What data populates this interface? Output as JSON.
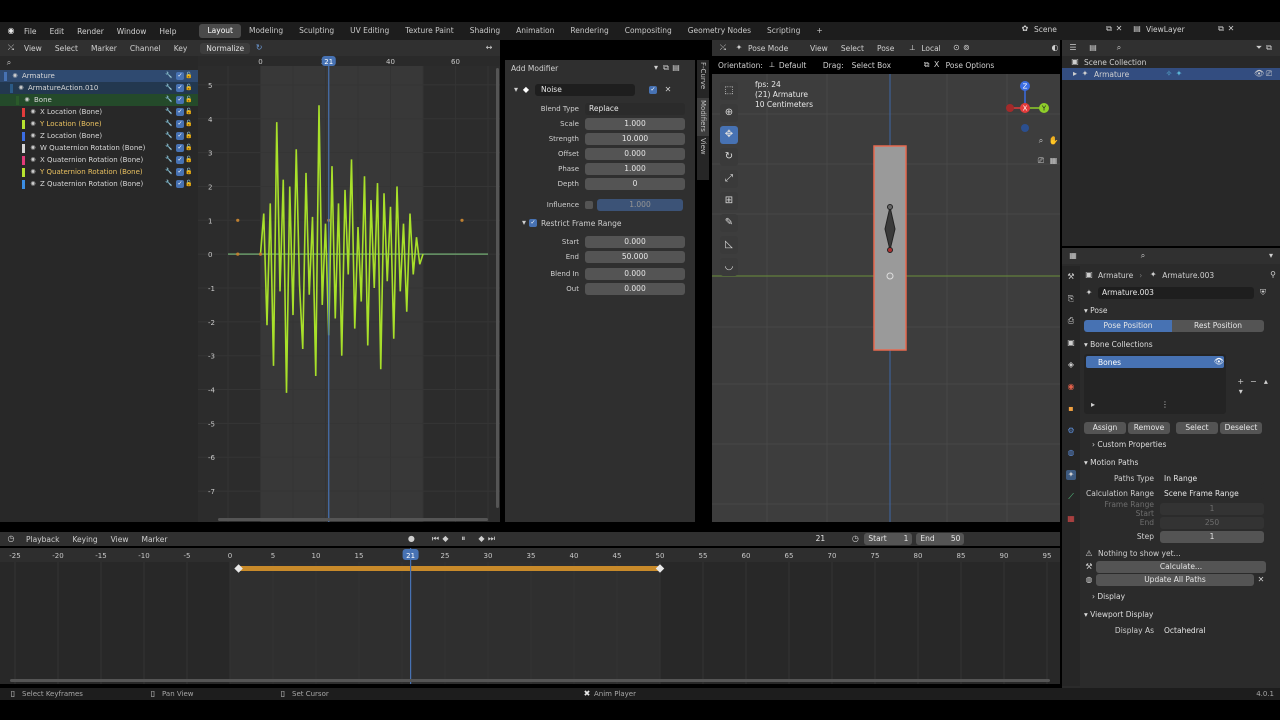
{
  "topbar": {
    "menus": [
      "File",
      "Edit",
      "Render",
      "Window",
      "Help"
    ],
    "workspaces": [
      "Layout",
      "Modeling",
      "Sculpting",
      "UV Editing",
      "Texture Paint",
      "Shading",
      "Animation",
      "Rendering",
      "Compositing",
      "Geometry Nodes",
      "Scripting"
    ],
    "active_workspace": "Layout",
    "add_tab": "+",
    "scene": "Scene",
    "view_layer": "ViewLayer"
  },
  "graph_editor": {
    "menus": [
      "View",
      "Select",
      "Marker",
      "Channel",
      "Key"
    ],
    "normalize": "Normalize",
    "frame_ticks": [
      "0",
      "20",
      "40",
      "60"
    ],
    "current_frame": "21",
    "y_ticks": [
      "5",
      "4",
      "3",
      "2",
      "1",
      "0",
      "-1",
      "-2",
      "-3",
      "-4",
      "-5",
      "-6",
      "-7"
    ],
    "channels": [
      {
        "name": "Armature",
        "color": "#4772b3",
        "level": 0
      },
      {
        "name": "ArmatureAction.010",
        "color": "#2b5a86",
        "level": 1
      },
      {
        "name": "Bone",
        "color": "#2a5a2a",
        "level": 2
      },
      {
        "name": "X Location (Bone)",
        "color": "#e23b3b",
        "level": 3
      },
      {
        "name": "Y Location (Bone)",
        "color": "#b6e32f",
        "level": 3
      },
      {
        "name": "Z Location (Bone)",
        "color": "#3b6de2",
        "level": 3
      },
      {
        "name": "W Quaternion Rotation (Bone)",
        "color": "#d6d6d6",
        "level": 3
      },
      {
        "name": "X Quaternion Rotation (Bone)",
        "color": "#e23b7a",
        "level": 3
      },
      {
        "name": "Y Quaternion Rotation (Bone)",
        "color": "#b6e32f",
        "level": 3
      },
      {
        "name": "Z Quaternion Rotation (Bone)",
        "color": "#3b8de2",
        "level": 3
      }
    ]
  },
  "modifiers": {
    "add_modifier": "Add Modifier",
    "name": "Noise",
    "blend_type_label": "Blend Type",
    "blend_type": "Replace",
    "props": [
      {
        "label": "Scale",
        "value": "1.000"
      },
      {
        "label": "Strength",
        "value": "10.000"
      },
      {
        "label": "Offset",
        "value": "0.000"
      },
      {
        "label": "Phase",
        "value": "1.000"
      },
      {
        "label": "Depth",
        "value": "0"
      }
    ],
    "influence_label": "Influence",
    "influence": "1.000",
    "restrict_label": "Restrict Frame Range",
    "range": [
      {
        "label": "Start",
        "value": "0.000"
      },
      {
        "label": "End",
        "value": "50.000"
      },
      {
        "label": "Blend In",
        "value": "0.000"
      },
      {
        "label": "Out",
        "value": "0.000"
      }
    ],
    "side_tabs": [
      "F-Curve",
      "Modifiers",
      "View"
    ]
  },
  "viewport": {
    "mode": "Pose Mode",
    "menus": [
      "View",
      "Select",
      "Pose"
    ],
    "transform": "Local",
    "orientation_label": "Orientation:",
    "orientation": "Default",
    "drag_label": "Drag:",
    "drag": "Select Box",
    "pose_options": "Pose Options",
    "overlay": [
      "fps: 24",
      "(21) Armature",
      "10 Centimeters"
    ],
    "gizmo_labels": {
      "z": "Z",
      "y": "Y",
      "x": "X"
    }
  },
  "outliner": {
    "title": "Scene Collection",
    "item": "Armature"
  },
  "properties": {
    "breadcrumb_obj": "Armature",
    "breadcrumb_data": "Armature.003",
    "data_name": "Armature.003",
    "pose_section": "Pose",
    "pose_position": "Pose Position",
    "rest_position": "Rest Position",
    "bone_collections": "Bone Collections",
    "bones": "Bones",
    "assign": "Assign",
    "remove": "Remove",
    "select": "Select",
    "deselect": "Deselect",
    "custom_props": "Custom Properties",
    "motion_paths": "Motion Paths",
    "paths_type_label": "Paths Type",
    "paths_type": "In Range",
    "calc_range_label": "Calculation Range",
    "calc_range": "Scene Frame Range",
    "frame_range_start_label": "Frame Range Start",
    "frame_range_start": "1",
    "end_label": "End",
    "end": "250",
    "step_label": "Step",
    "step": "1",
    "nothing": "Nothing to show yet...",
    "calculate": "Calculate...",
    "update_all": "Update All Paths",
    "display": "Display",
    "viewport_display": "Viewport Display",
    "display_as_label": "Display As",
    "display_as": "Octahedral"
  },
  "timeline": {
    "menus": [
      "Playback",
      "Keying",
      "View",
      "Marker"
    ],
    "current_frame": "21",
    "start_label": "Start",
    "start": "1",
    "end_label": "End",
    "end": "50",
    "ticks": [
      "-25",
      "-20",
      "-15",
      "-10",
      "-5",
      "0",
      "5",
      "10",
      "15",
      "21",
      "25",
      "30",
      "35",
      "40",
      "45",
      "50",
      "55",
      "60",
      "65",
      "70",
      "75",
      "80",
      "85",
      "90",
      "95"
    ]
  },
  "statusbar": {
    "select": "Select Keyframes",
    "pan": "Pan View",
    "cursor": "Set Cursor",
    "center": "Anim Player",
    "version": "4.0.1"
  },
  "chart_data": {
    "type": "line",
    "series": [
      {
        "name": "Y Location (Bone)",
        "color": "#a8e02a",
        "x": [
          0,
          1,
          2,
          3,
          4,
          5,
          6,
          7,
          8,
          9,
          10,
          11,
          12,
          13,
          14,
          15,
          16,
          17,
          18,
          19,
          20,
          21,
          22,
          23,
          24,
          25,
          26,
          27,
          28,
          29,
          30,
          31,
          32,
          33,
          34,
          35,
          36,
          37,
          38,
          39,
          40,
          41,
          42,
          43,
          44,
          45,
          46,
          47,
          48,
          49,
          50
        ],
        "values": [
          0,
          1.2,
          -2.1,
          1.5,
          -3.3,
          3.9,
          -1.1,
          2.2,
          -4.1,
          2.0,
          -1.8,
          3.1,
          -0.9,
          -2.8,
          2.4,
          -1.2,
          1.1,
          -3.6,
          4.4,
          -1.5,
          0.9,
          -2.4,
          2.6,
          -1.9,
          1.5,
          -3.0,
          1.9,
          -0.6,
          2.8,
          -2.2,
          0.8,
          -1.4,
          2.3,
          -2.7,
          1.6,
          -1.0,
          2.1,
          -3.4,
          1.8,
          -0.8,
          1.4,
          -2.5,
          2.0,
          -1.1,
          0.9,
          -1.7,
          1.2,
          -0.6,
          0.5,
          -0.3,
          0
        ]
      },
      {
        "name": "X Location (Bone)",
        "color": "#6a9a6a",
        "x": [
          -10,
          70
        ],
        "values": [
          0,
          0
        ]
      }
    ],
    "xlim": [
      -10,
      70
    ],
    "ylim": [
      -7.5,
      5.5
    ],
    "cursor": 21
  }
}
